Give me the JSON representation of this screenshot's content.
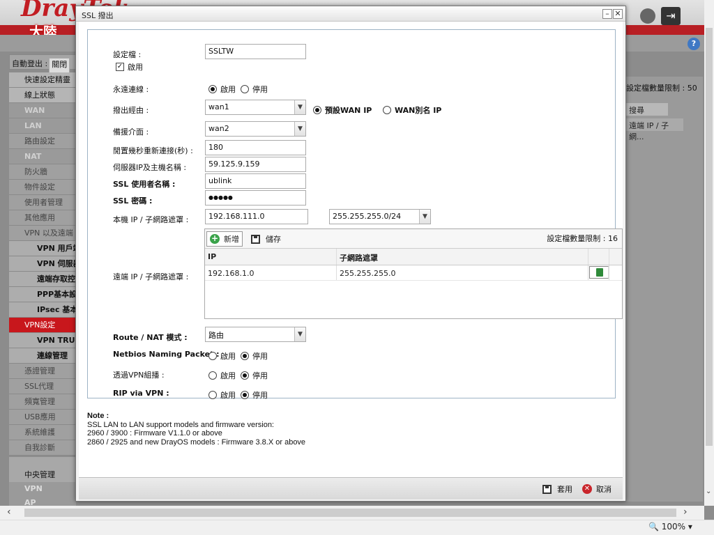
{
  "background": {
    "logo": "DrayTek",
    "region": "大陸",
    "auto_logout_label": "自動登出 :",
    "auto_logout_value": "關閉",
    "sidebar": [
      {
        "label": "快速設定精靈",
        "kind": "top"
      },
      {
        "label": "線上狀態",
        "kind": "top"
      },
      {
        "label": "WAN",
        "kind": "sec"
      },
      {
        "label": "LAN",
        "kind": "sec"
      },
      {
        "label": "路由設定",
        "kind": "plain"
      },
      {
        "label": "NAT",
        "kind": "sec"
      },
      {
        "label": "防火牆",
        "kind": "plain"
      },
      {
        "label": "物件設定",
        "kind": "plain"
      },
      {
        "label": "使用者管理",
        "kind": "plain"
      },
      {
        "label": "其他應用",
        "kind": "plain"
      },
      {
        "label": "VPN 以及遠端",
        "kind": "plain"
      },
      {
        "label": "VPN 用戶端",
        "kind": "sub"
      },
      {
        "label": "VPN 伺服器",
        "kind": "sub"
      },
      {
        "label": "遠端存取控",
        "kind": "sub"
      },
      {
        "label": "PPP基本設",
        "kind": "sub"
      },
      {
        "label": "IPsec 基本",
        "kind": "sub"
      },
      {
        "label": "VPN設定",
        "kind": "act"
      },
      {
        "label": "VPN TRUN",
        "kind": "sub"
      },
      {
        "label": "連線管理",
        "kind": "sub"
      },
      {
        "label": "憑證管理",
        "kind": "plain"
      },
      {
        "label": "SSL代理",
        "kind": "plain"
      },
      {
        "label": "頻寬管理",
        "kind": "plain"
      },
      {
        "label": "USB應用",
        "kind": "plain"
      },
      {
        "label": "系統維護",
        "kind": "plain"
      },
      {
        "label": "自我診斷",
        "kind": "plain"
      }
    ],
    "central_mgmt": "中央管理",
    "central_items": [
      "VPN",
      "AP"
    ],
    "right_limit": "設定檔數量限制 : 50",
    "right_search": "搜尋",
    "right_col": "遠端 IP / 子網...",
    "zoom": "100%"
  },
  "dialog": {
    "title": "SSL 撥出",
    "profile_label": "設定檔 :",
    "profile_value": "SSLTW",
    "enable_label": "啟用",
    "always_on_label": "永遠連線 :",
    "always_on_on": "啟用",
    "always_on_off": "停用",
    "dial_via_label": "撥出經由 :",
    "dial_via_value": "wan1",
    "default_wan_ip": "預設WAN IP",
    "wan_alias_ip": "WAN別名 IP",
    "backup_label": "備援介面 :",
    "backup_value": "wan2",
    "reconnect_label": "閒置幾秒重新連接(秒) :",
    "reconnect_value": "180",
    "server_label": "伺服器IP及主機名稱 :",
    "server_value": "59.125.9.159",
    "ssl_user_label": "SSL 使用者名稱 :",
    "ssl_user_value": "ublink",
    "ssl_pass_label": "SSL 密碼 :",
    "ssl_pass_value": "●●●●●",
    "local_ip_label": "本機 IP / 子網路遮罩 :",
    "local_ip_value": "192.168.111.0",
    "local_mask_value": "255.255.255.0/24",
    "remote_label": "遠端 IP / 子網路遮罩 :",
    "add_label": "新增",
    "save_label": "儲存",
    "limit_label": "設定檔數量限制 : 16",
    "col_ip": "IP",
    "col_mask": "子網路遮罩",
    "remote_rows": [
      {
        "ip": "192.168.1.0",
        "mask": "255.255.255.0"
      }
    ],
    "route_nat_label": "Route / NAT 模式 :",
    "route_nat_value": "路由",
    "netbios_label": "Netbios Naming Packet :",
    "vpn_multicast_label": "透過VPN組播 :",
    "rip_label": "RIP via VPN :",
    "opt_on": "啟用",
    "opt_off": "停用",
    "note_title": "Note :",
    "note_lines": [
      "SSL LAN to LAN support models and firmware version:",
      "2960 / 3900 : Firmware V1.1.0 or above",
      "2860 / 2925 and new DrayOS models : Firmware 3.8.X or above"
    ],
    "apply_label": "套用",
    "cancel_label": "取消"
  },
  "colors": {
    "accent_red": "#c8171c",
    "add_green": "#3aa34a",
    "frame_blue": "#9db3c5"
  }
}
